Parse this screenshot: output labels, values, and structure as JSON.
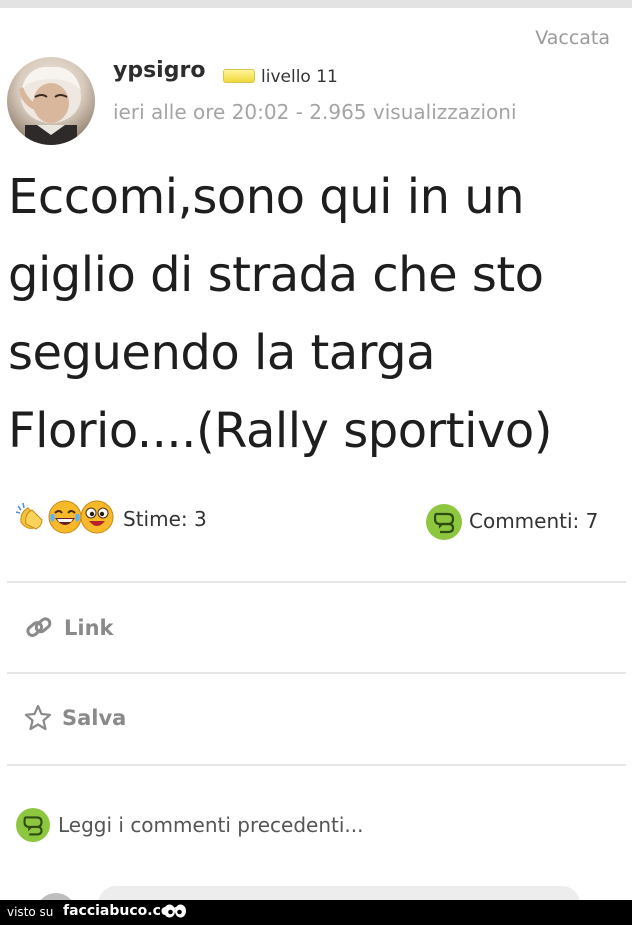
{
  "post": {
    "category": "Vaccata",
    "username": "ypsigro",
    "level": "livello 11",
    "meta": "ieri alle ore 20:02 - 2.965 visualizzazioni",
    "text": "Eccomi,sono qui in un giglio di strada che sto seguendo la targa Florio....(Rally sportivo)"
  },
  "stats": {
    "stime": "Stime: 3",
    "commenti": "Commenti: 7"
  },
  "actions": {
    "link": "Link",
    "salva": "Salva"
  },
  "comments": {
    "older_link": "Leggi i commenti precedenti..."
  },
  "footer": {
    "visto": "visto su",
    "site": "facciabuco.com"
  },
  "colors": {
    "accent_green": "#8dc63f",
    "muted_text": "#a4a4a4",
    "level_badge": "#f0d83a"
  },
  "icons": [
    "clap-emoji",
    "laugh-emoji",
    "wow-emoji",
    "comment-bubble-icon",
    "link-icon",
    "star-icon",
    "eyes-logo-icon"
  ]
}
